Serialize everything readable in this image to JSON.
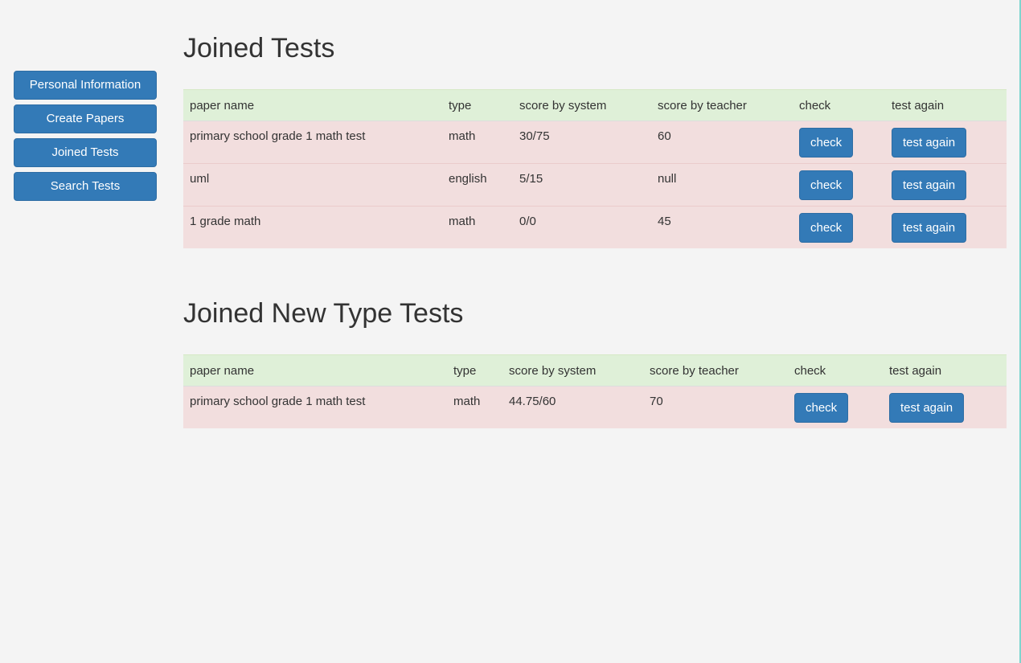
{
  "sidebar": {
    "items": [
      {
        "label": "Personal Information"
      },
      {
        "label": "Create Papers"
      },
      {
        "label": "Joined Tests"
      },
      {
        "label": "Search Tests"
      }
    ]
  },
  "joined_tests": {
    "title": "Joined Tests",
    "columns": [
      "paper name",
      "type",
      "score by system",
      "score by teacher",
      "check",
      "test again"
    ],
    "rows": [
      {
        "paper_name": "primary school grade 1 math test",
        "type": "math",
        "score_by_system": "30/75",
        "score_by_teacher": "60",
        "check_label": "check",
        "test_again_label": "test again"
      },
      {
        "paper_name": "uml",
        "type": "english",
        "score_by_system": "5/15",
        "score_by_teacher": "null",
        "check_label": "check",
        "test_again_label": "test again"
      },
      {
        "paper_name": "1 grade math",
        "type": "math",
        "score_by_system": "0/0",
        "score_by_teacher": "45",
        "check_label": "check",
        "test_again_label": "test again"
      }
    ]
  },
  "joined_new_type_tests": {
    "title": "Joined New Type Tests",
    "columns": [
      "paper name",
      "type",
      "score by system",
      "score by teacher",
      "check",
      "test again"
    ],
    "rows": [
      {
        "paper_name": "primary school grade 1 math test",
        "type": "math",
        "score_by_system": "44.75/60",
        "score_by_teacher": "70",
        "check_label": "check",
        "test_again_label": "test again"
      }
    ]
  },
  "colors": {
    "background": "#f4f4f4",
    "primary_button": "#337ab7",
    "header_row": "#dff0d8",
    "data_row": "#f2dede"
  }
}
